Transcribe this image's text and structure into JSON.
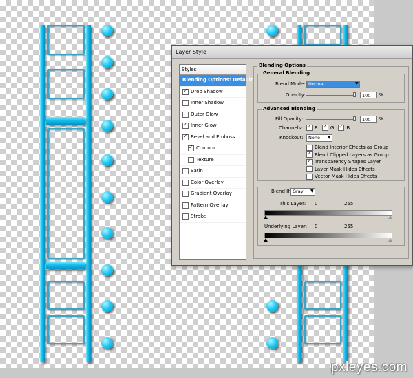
{
  "dialog": {
    "title": "Layer Style",
    "styles_header": "Styles",
    "styles": [
      {
        "label": "Blending Options: Default",
        "checkbox": false,
        "checked": false,
        "selected": true
      },
      {
        "label": "Drop Shadow",
        "checkbox": true,
        "checked": true
      },
      {
        "label": "Inner Shadow",
        "checkbox": true,
        "checked": false
      },
      {
        "label": "Outer Glow",
        "checkbox": true,
        "checked": false
      },
      {
        "label": "Inner Glow",
        "checkbox": true,
        "checked": true
      },
      {
        "label": "Bevel and Emboss",
        "checkbox": true,
        "checked": true
      },
      {
        "label": "Contour",
        "checkbox": true,
        "checked": true,
        "sub": true
      },
      {
        "label": "Texture",
        "checkbox": true,
        "checked": false,
        "sub": true
      },
      {
        "label": "Satin",
        "checkbox": true,
        "checked": false
      },
      {
        "label": "Color Overlay",
        "checkbox": true,
        "checked": false
      },
      {
        "label": "Gradient Overlay",
        "checkbox": true,
        "checked": false
      },
      {
        "label": "Pattern Overlay",
        "checkbox": true,
        "checked": false
      },
      {
        "label": "Stroke",
        "checkbox": true,
        "checked": false
      }
    ],
    "blending": {
      "section_title": "Blending Options",
      "general_title": "General Blending",
      "blend_mode_label": "Blend Mode:",
      "blend_mode_value": "Normal",
      "opacity_label": "Opacity:",
      "opacity_value": "100",
      "opacity_unit": "%",
      "advanced_title": "Advanced Blending",
      "fill_opacity_label": "Fill Opacity:",
      "fill_opacity_value": "100",
      "fill_opacity_unit": "%",
      "channels_label": "Channels:",
      "channels": [
        {
          "label": "R",
          "checked": true
        },
        {
          "label": "G",
          "checked": true
        },
        {
          "label": "B",
          "checked": true
        }
      ],
      "knockout_label": "Knockout:",
      "knockout_value": "None",
      "options": [
        {
          "label": "Blend Interior Effects as Group",
          "checked": false
        },
        {
          "label": "Blend Clipped Layers as Group",
          "checked": true
        },
        {
          "label": "Transparency Shapes Layer",
          "checked": true
        },
        {
          "label": "Layer Mask Hides Effects",
          "checked": false
        },
        {
          "label": "Vector Mask Hides Effects",
          "checked": false
        }
      ],
      "blend_if_label": "Blend If:",
      "blend_if_value": "Gray",
      "this_layer_label": "This Layer:",
      "this_layer_min": "0",
      "this_layer_max": "255",
      "underlying_label": "Underlying Layer:",
      "underlying_min": "0",
      "underlying_max": "255"
    }
  },
  "watermark": "pxleyes.com",
  "colors": {
    "cyan": "#13bfee",
    "selection_blue": "#3b8fe3",
    "dialog_gray": "#d4d0c8"
  }
}
